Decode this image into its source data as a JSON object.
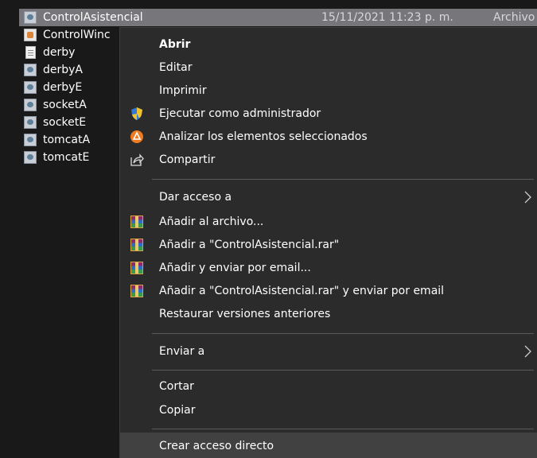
{
  "files": [
    {
      "name": "ControlAsistencial",
      "date": "15/11/2021 11:23 p. m.",
      "type": "Archivo po",
      "icon": "rdp-file-icon",
      "selected": true
    },
    {
      "name": "ControlWinc",
      "icon": "java-file-icon"
    },
    {
      "name": "derby",
      "icon": "text-file-icon"
    },
    {
      "name": "derbyA",
      "icon": "rdp-file-icon"
    },
    {
      "name": "derbyE",
      "icon": "rdp-file-icon"
    },
    {
      "name": "socketA",
      "icon": "rdp-file-icon"
    },
    {
      "name": "socketE",
      "icon": "rdp-file-icon"
    },
    {
      "name": "tomcatA",
      "icon": "rdp-file-icon"
    },
    {
      "name": "tomcatE",
      "icon": "rdp-file-icon"
    }
  ],
  "menu": {
    "open": "Abrir",
    "edit": "Editar",
    "print": "Imprimir",
    "run_as_admin": "Ejecutar como administrador",
    "scan": "Analizar los elementos seleccionados",
    "share": "Compartir",
    "give_access": "Dar acceso a",
    "add_to_archive": "Añadir al archivo...",
    "add_to_rar": "Añadir a \"ControlAsistencial.rar\"",
    "add_email": "Añadir y enviar por email...",
    "add_rar_email": "Añadir a \"ControlAsistencial.rar\" y enviar por email",
    "restore": "Restaurar versiones anteriores",
    "send_to": "Enviar a",
    "cut": "Cortar",
    "copy": "Copiar",
    "create_shortcut": "Crear acceso directo"
  },
  "colors": {
    "background": "#191919",
    "menu_background": "#2b2b2b",
    "selected_row": "#77777b",
    "hover_item": "#414141",
    "shield_blue": "#2f7ad6",
    "shield_yellow": "#f2c12e",
    "avast_orange": "#f07a20"
  }
}
